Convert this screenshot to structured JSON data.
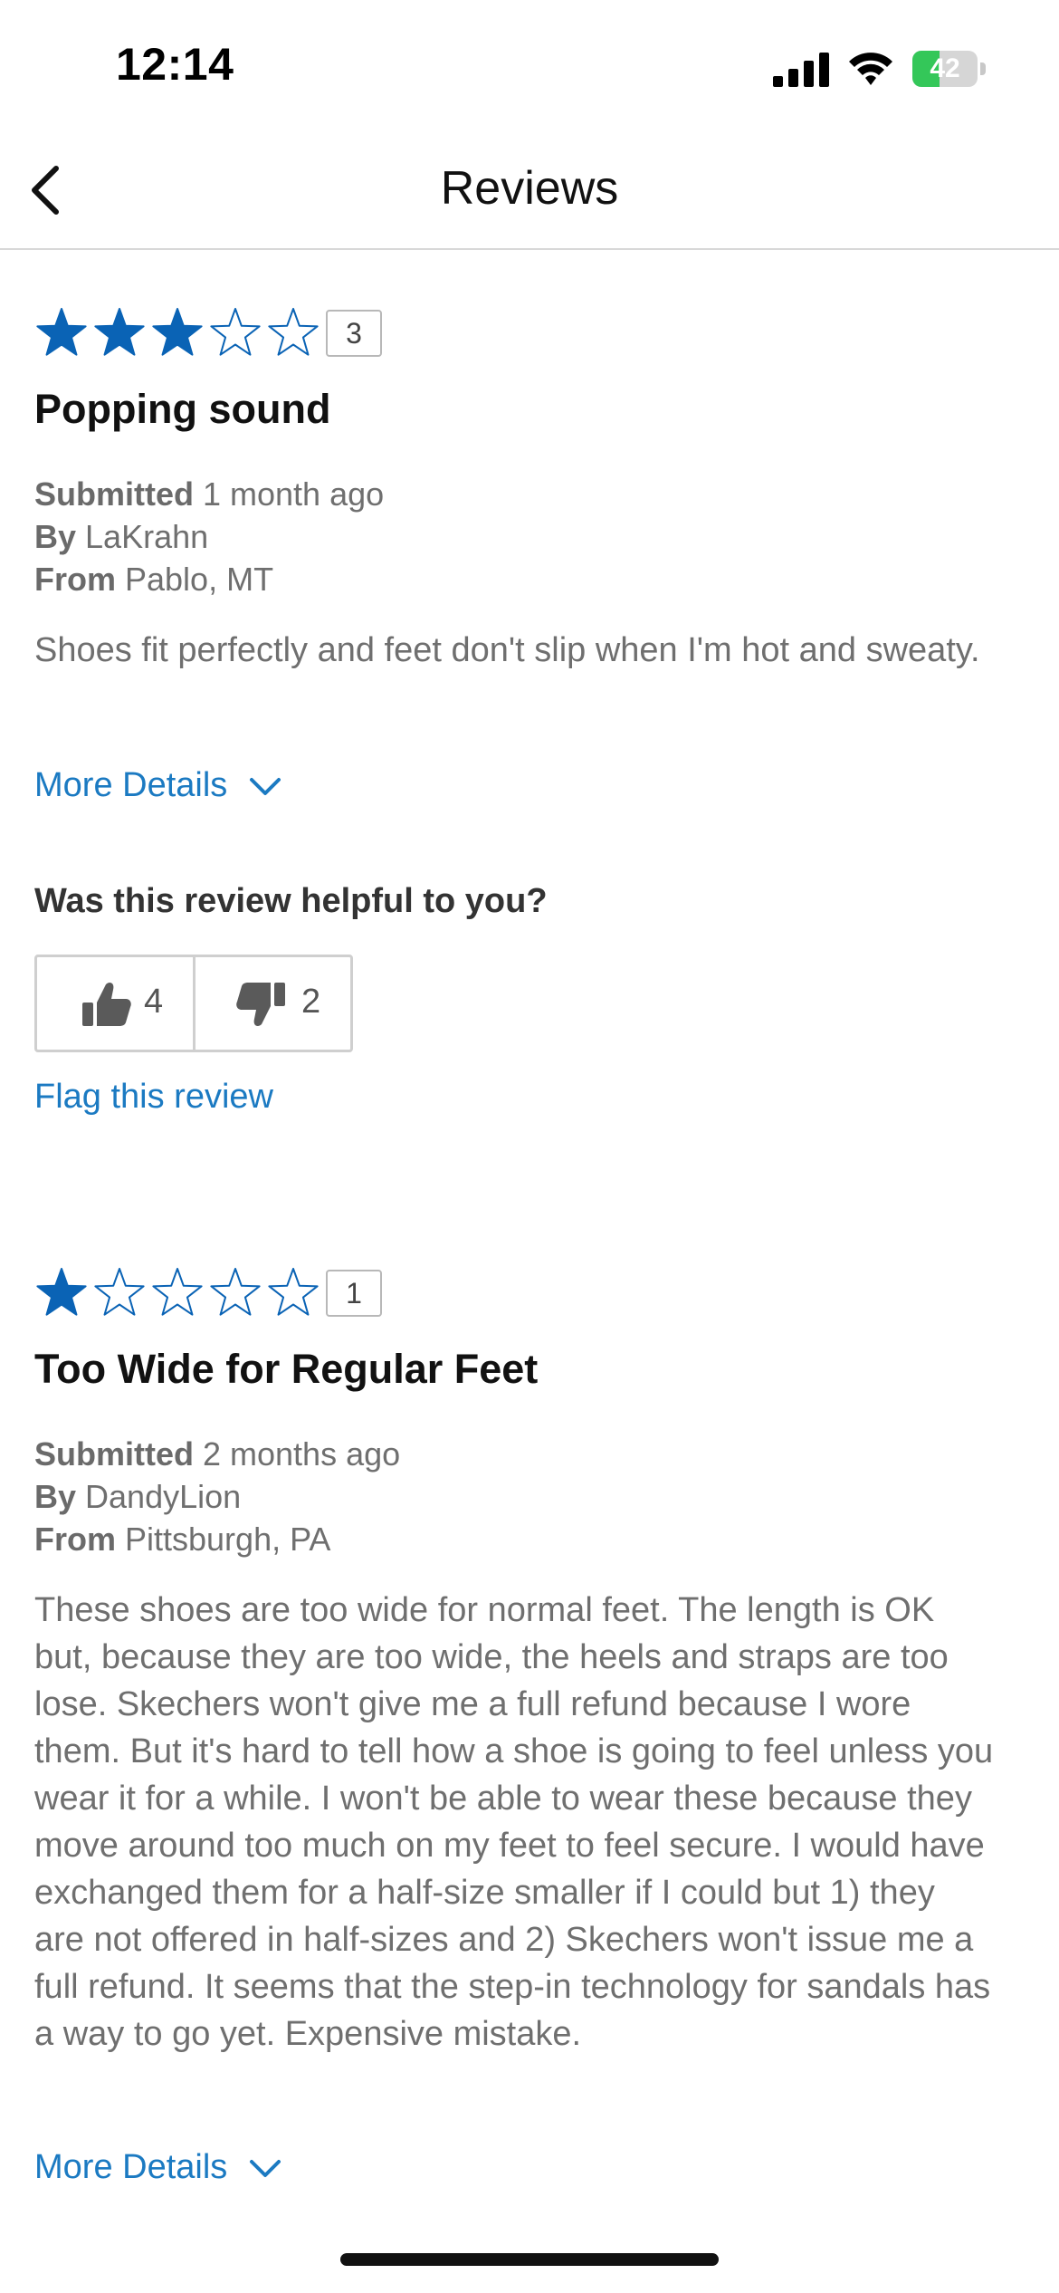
{
  "status_bar": {
    "time": "12:14",
    "battery_percent": "42",
    "battery_level": 0.42
  },
  "nav": {
    "title": "Reviews"
  },
  "reviews": [
    {
      "rating": 3,
      "rating_badge": "3",
      "title": "Popping sound",
      "submitted_label": "Submitted",
      "submitted_value": " 1 month ago",
      "by_label": "By",
      "by_value": " LaKrahn",
      "from_label": "From",
      "from_value": " Pablo, MT",
      "body": "Shoes fit perfectly and feet don't slip when I'm hot and sweaty.",
      "more_details": "More Details",
      "helpful_question": "Was this review helpful to you?",
      "helpful_yes": "4",
      "helpful_no": "2",
      "flag": "Flag this review"
    },
    {
      "rating": 1,
      "rating_badge": "1",
      "title": "Too Wide for Regular Feet",
      "submitted_label": "Submitted",
      "submitted_value": " 2 months ago",
      "by_label": "By",
      "by_value": " DandyLion",
      "from_label": "From",
      "from_value": " Pittsburgh, PA",
      "body": "These shoes are too wide for normal feet. The length is OK but, because they are too wide, the heels and straps are too lose. Skechers won't give me a full refund because I wore them. But it's hard to tell how a shoe is going to feel unless you wear it for a while. I won't be able to wear these because they move around too much on my feet to feel secure. I would have exchanged them for a half-size smaller if I could but 1) they are not offered in half-sizes and 2) Skechers won't issue me a full refund. It seems that the step-in technology for sandals has a way to go yet. Expensive mistake.",
      "more_details": "More Details"
    }
  ],
  "colors": {
    "star": "#0a63b5",
    "link": "#1b7ac2",
    "battery": "#34c759"
  }
}
